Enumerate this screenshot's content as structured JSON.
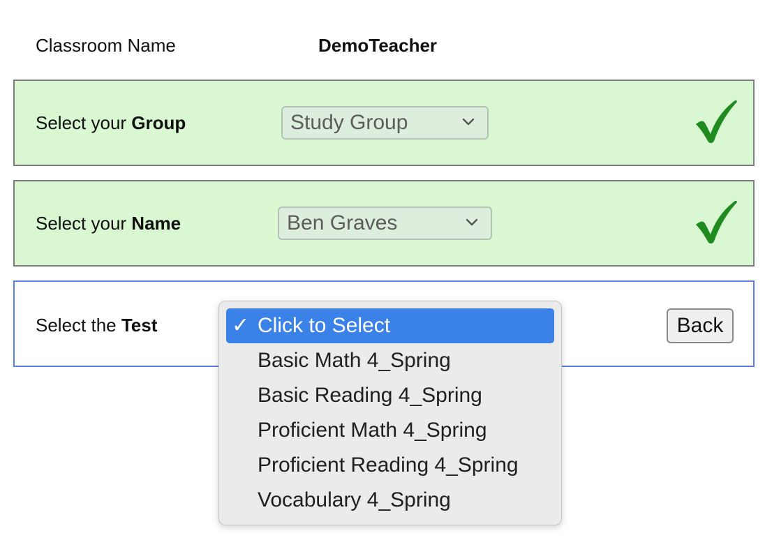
{
  "classroom": {
    "label": "Classroom Name",
    "value": "DemoTeacher"
  },
  "group_panel": {
    "label_prefix": "Select your ",
    "label_bold": "Group",
    "selected_value": "Study Group",
    "status": "complete",
    "status_icon": "checkmark-icon",
    "status_color": "#1f8a1f"
  },
  "name_panel": {
    "label_prefix": "Select your ",
    "label_bold": "Name",
    "selected_value": "Ben Graves",
    "status": "complete",
    "status_icon": "checkmark-icon",
    "status_color": "#1f8a1f"
  },
  "test_panel": {
    "label_prefix": "Select the ",
    "label_bold": "Test",
    "back_label": "Back"
  },
  "test_dropdown": {
    "check_mark": "✓",
    "options": [
      {
        "label": "Click to Select",
        "selected": true
      },
      {
        "label": "Basic Math 4_Spring",
        "selected": false
      },
      {
        "label": "Basic Reading 4_Spring",
        "selected": false
      },
      {
        "label": "Proficient Math 4_Spring",
        "selected": false
      },
      {
        "label": "Proficient Reading 4_Spring",
        "selected": false
      },
      {
        "label": "Vocabulary 4_Spring",
        "selected": false
      }
    ]
  },
  "colors": {
    "completed_panel_bg": "#d9f8d2",
    "active_panel_border": "#5b7fe0",
    "selection_highlight": "#3b82e8"
  }
}
